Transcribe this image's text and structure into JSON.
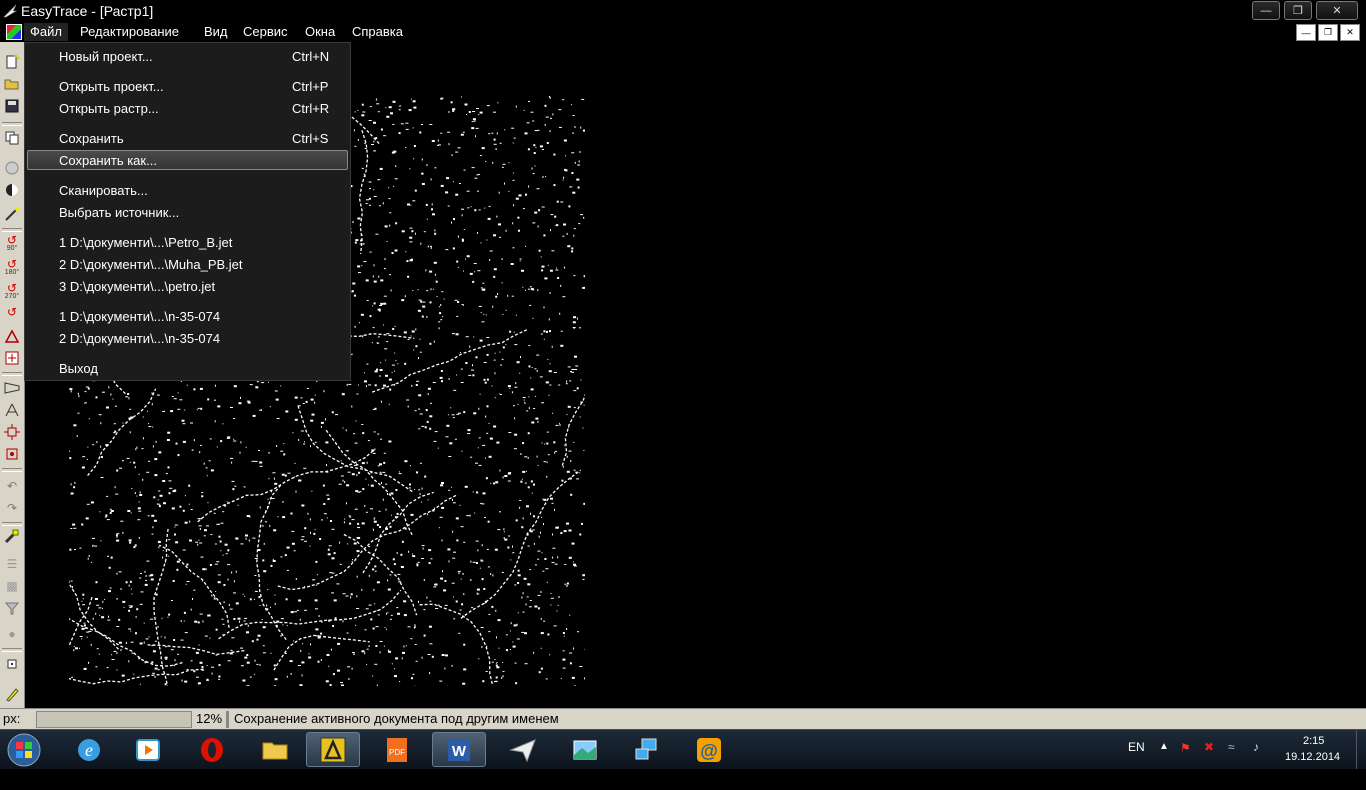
{
  "window": {
    "title": "EasyTrace - [Растр1]"
  },
  "menubar": {
    "items": [
      "Файл",
      "Редактирование",
      "Вид",
      "Сервис",
      "Окна",
      "Справка"
    ]
  },
  "file_menu": {
    "items": [
      {
        "label": "Новый проект...",
        "shortcut": "Ctrl+N"
      },
      {
        "label": "Открыть проект...",
        "shortcut": "Ctrl+P"
      },
      {
        "label": "Открыть растр...",
        "shortcut": "Ctrl+R"
      },
      {
        "label": "Сохранить",
        "shortcut": "Ctrl+S"
      },
      {
        "label": "Сохранить как...",
        "shortcut": ""
      },
      {
        "label": "Сканировать...",
        "shortcut": ""
      },
      {
        "label": "Выбрать источник...",
        "shortcut": ""
      },
      {
        "label": "1 D:\\документи\\...\\Petro_B.jet",
        "shortcut": ""
      },
      {
        "label": "2 D:\\документи\\...\\Muha_PB.jet",
        "shortcut": ""
      },
      {
        "label": "3 D:\\документи\\...\\petro.jet",
        "shortcut": ""
      },
      {
        "label": "1 D:\\документи\\...\\n-35-074",
        "shortcut": ""
      },
      {
        "label": "2 D:\\документи\\...\\n-35-074",
        "shortcut": ""
      },
      {
        "label": "Выход",
        "shortcut": ""
      }
    ],
    "highlighted_index": 4
  },
  "left_toolbar": {
    "rotate_labels": [
      "90°",
      "180°",
      "270°"
    ]
  },
  "statusbar": {
    "coord_label": "px:",
    "zoom": "12%",
    "message": "Сохранение активного документа под другим именем"
  },
  "taskbar": {
    "lang": "EN",
    "time": "2:15",
    "date": "19.12.2014"
  },
  "colors": {
    "menu_bg": "#1c1c1c",
    "highlight": "#444444",
    "toolbar_bg": "#d8d4c8",
    "taskbar_bg": "#15202b"
  }
}
